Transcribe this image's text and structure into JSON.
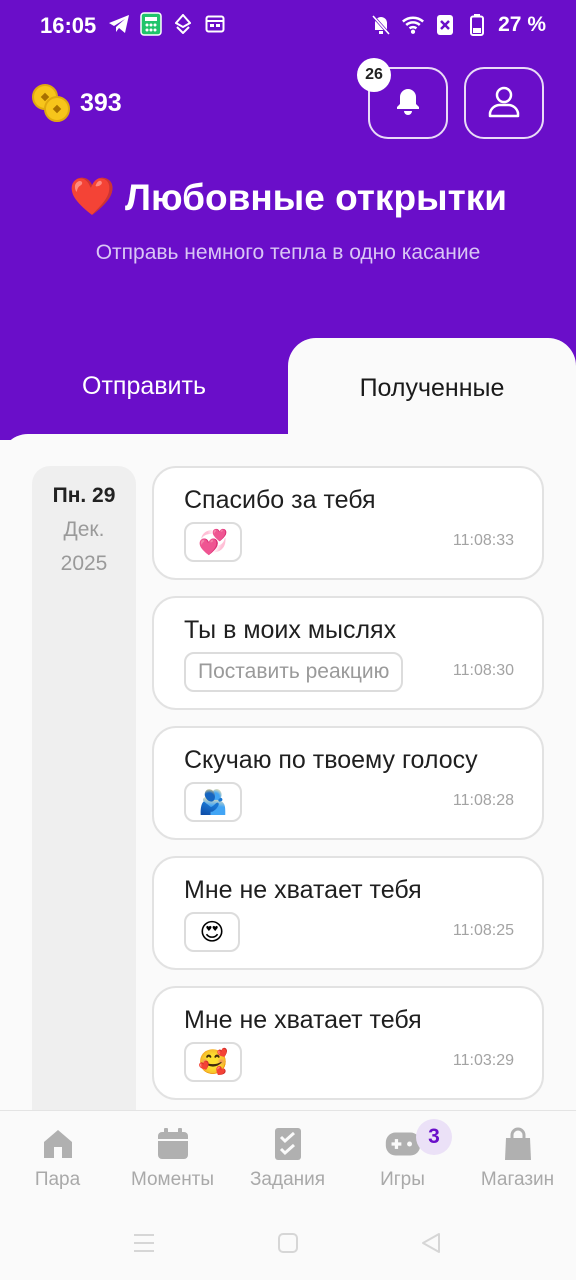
{
  "status_bar": {
    "time": "16:05",
    "battery": "27 %",
    "icons_left": [
      "telegram-icon",
      "calculator-icon",
      "vpn-icon",
      "calendar-icon"
    ],
    "icons_right": [
      "mute-icon",
      "wifi-icon",
      "sim-icon",
      "battery-icon"
    ]
  },
  "header": {
    "coins": "393",
    "notifications_count": "26",
    "title_emoji": "❤️",
    "title": "Любовные открытки",
    "subtitle": "Отправь немного тепла в одно касание"
  },
  "tabs": [
    {
      "label": "Отправить",
      "active": false
    },
    {
      "label": "Полученные",
      "active": true
    }
  ],
  "date": {
    "day": "Пн. 29",
    "month": "Дек.",
    "year": "2025"
  },
  "messages": [
    {
      "text": "Спасибо за тебя",
      "reaction": "💞",
      "time": "11:08:33"
    },
    {
      "text": "Ты в моих мыслях",
      "reaction_prompt": "Поставить реакцию",
      "time": "11:08:30"
    },
    {
      "text": "Скучаю по твоему голосу",
      "reaction": "🫂",
      "time": "11:08:28"
    },
    {
      "text": "Мне не хватает тебя",
      "reaction": "😍",
      "time": "11:08:25"
    },
    {
      "text": "Мне не хватает тебя",
      "reaction": "🥰",
      "time": "11:03:29"
    }
  ],
  "bottom_nav": [
    {
      "label": "Пара",
      "icon": "home-icon"
    },
    {
      "label": "Моменты",
      "icon": "calendar-icon"
    },
    {
      "label": "Задания",
      "icon": "tasks-icon"
    },
    {
      "label": "Игры",
      "icon": "gamepad-icon",
      "badge": "3"
    },
    {
      "label": "Магазин",
      "icon": "shopping-bag-icon"
    }
  ],
  "colors": {
    "primary": "#6a0ec9",
    "background": "#fafafa",
    "coin": "#f7c51b"
  }
}
